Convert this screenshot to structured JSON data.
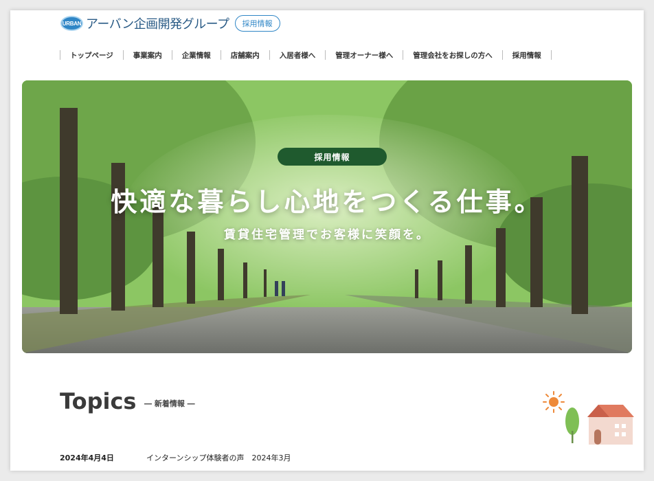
{
  "header": {
    "logo_mark": "URBAN",
    "logo_text": "アーバン企画開発グループ",
    "recruit_pill": "採用情報"
  },
  "nav": {
    "items": [
      {
        "label": "トップページ"
      },
      {
        "label": "事業案内"
      },
      {
        "label": "企業情報"
      },
      {
        "label": "店舗案内"
      },
      {
        "label": "入居者様へ"
      },
      {
        "label": "管理オーナー様へ"
      },
      {
        "label": "管理会社をお探しの方へ"
      },
      {
        "label": "採用情報"
      }
    ]
  },
  "hero": {
    "badge": "採用情報",
    "title": "快適な暮らし心地をつくる仕事。",
    "subtitle": "賃貸住宅管理でお客様に笑顔を。"
  },
  "topics": {
    "title": "Topics",
    "subtitle": "― 新着情報 ―",
    "news": [
      {
        "date": "2024年4月4日",
        "title": "インターンシップ体験者の声　2024年3月"
      }
    ]
  },
  "colors": {
    "brand_blue": "#2f86c6",
    "badge_green": "#1f5a2e"
  }
}
